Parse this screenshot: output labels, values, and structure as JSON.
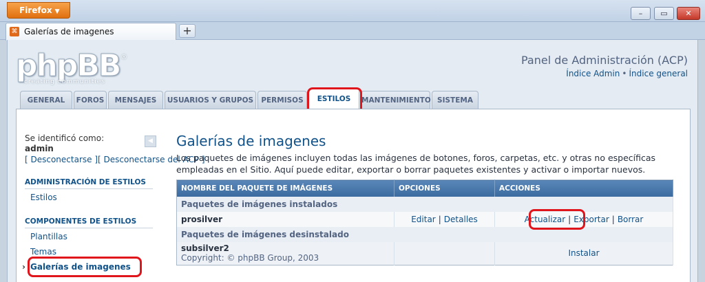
{
  "browser": {
    "app_button": "Firefox",
    "tab_title": "Galerías de imagenes",
    "new_tab": "+",
    "window_buttons": {
      "minimize": "–",
      "maximize": "▭",
      "close": "✕"
    }
  },
  "header": {
    "logo_text": "phpBB",
    "logo_sub": "creating communities",
    "logo_reg": "®",
    "title": "Panel de Administración (ACP)",
    "link_admin": "Índice Admin",
    "link_sep": "•",
    "link_general": "Índice general"
  },
  "nav_tabs": {
    "general": "GENERAL",
    "foros": "FOROS",
    "mensajes": "MENSAJES",
    "usuarios": "USUARIOS Y GRUPOS",
    "permisos": "PERMISOS",
    "estilos": "ESTILOS",
    "mantenimiento": "MANTENIMIENTO",
    "sistema": "SISTEMA",
    "active": "estilos"
  },
  "sidebar": {
    "logged_in_label": "Se identificó como:",
    "username": "admin",
    "logout_link": "[ Desconectarse ][ Desconectarse del ACP ]",
    "collapse_icon": "◀",
    "sections": [
      {
        "header": "ADMINISTRACIÓN DE ESTILOS",
        "items": [
          "Estilos"
        ]
      },
      {
        "header": "COMPONENTES DE ESTILOS",
        "items": [
          "Plantillas",
          "Temas",
          "Galerías de imagenes"
        ]
      }
    ],
    "current_item": "Galerías de imagenes"
  },
  "main": {
    "title": "Galerías de imagenes",
    "description": "Los paquetes de imágenes incluyen todas las imágenes de botones, foros, carpetas, etc. y otras no específicas empleadas en el Sitio. Aquí puede editar, exportar o borrar paquetes existentes y activar o importar nuevos.",
    "table": {
      "columns": [
        "NOMBRE DEL PAQUETE DE IMÁGENES",
        "OPCIONES",
        "ACCIONES"
      ],
      "group_installed": "Paquetes de imágenes instalados",
      "installed": [
        {
          "name": "prosilver",
          "options": [
            "Editar",
            "Detalles"
          ],
          "actions": [
            "Actualizar",
            "Exportar",
            "Borrar"
          ]
        }
      ],
      "group_uninstalled": "Paquetes de imágenes desinstalado",
      "uninstalled": [
        {
          "name": "subsilver2",
          "copyright": "Copyright: © phpBB Group, 2003",
          "action": "Instalar"
        }
      ],
      "separator": "|"
    }
  },
  "colors": {
    "highlight": "#e0141b",
    "link": "#105289",
    "header_blue": "#3a6a9f"
  }
}
